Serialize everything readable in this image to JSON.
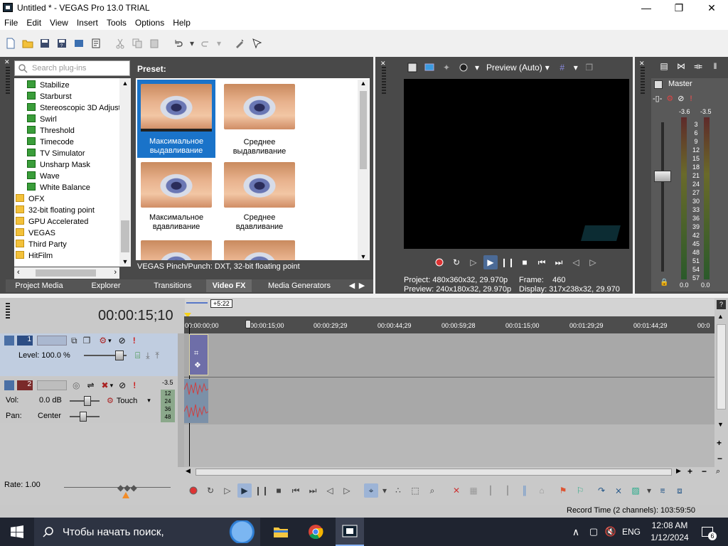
{
  "window": {
    "title": "Untitled * - VEGAS Pro 13.0 TRIAL"
  },
  "menu": [
    "File",
    "Edit",
    "View",
    "Insert",
    "Tools",
    "Options",
    "Help"
  ],
  "explorer": {
    "search_placeholder": "Search plug-ins",
    "tree": [
      {
        "label": "Stabilize",
        "kind": "fx"
      },
      {
        "label": "Starburst",
        "kind": "fx"
      },
      {
        "label": "Stereoscopic 3D Adjust",
        "kind": "fx"
      },
      {
        "label": "Swirl",
        "kind": "fx"
      },
      {
        "label": "Threshold",
        "kind": "fx"
      },
      {
        "label": "Timecode",
        "kind": "fx"
      },
      {
        "label": "TV Simulator",
        "kind": "fx"
      },
      {
        "label": "Unsharp Mask",
        "kind": "fx"
      },
      {
        "label": "Wave",
        "kind": "fx"
      },
      {
        "label": "White Balance",
        "kind": "fx"
      },
      {
        "label": "OFX",
        "kind": "folder"
      },
      {
        "label": "32-bit floating point",
        "kind": "folder"
      },
      {
        "label": "GPU Accelerated",
        "kind": "folder"
      },
      {
        "label": "VEGAS",
        "kind": "folder"
      },
      {
        "label": "Third Party",
        "kind": "folder"
      },
      {
        "label": "HitFilm",
        "kind": "folder"
      }
    ],
    "preset_label": "Preset:",
    "presets": [
      {
        "label": "Максимальное выдавливание",
        "selected": true
      },
      {
        "label": "Среднее выдавливание",
        "selected": false
      },
      {
        "label": "Максимальное вдавливание",
        "selected": false
      },
      {
        "label": "Среднее вдавливание",
        "selected": false
      }
    ],
    "description": "VEGAS Pinch/Punch: DXT, 32-bit floating point",
    "tabs": [
      "Project Media",
      "Explorer",
      "Transitions",
      "Video FX",
      "Media Generators"
    ],
    "active_tab": "Video FX"
  },
  "preview": {
    "quality": "Preview (Auto)",
    "project_label": "Project:",
    "project_value": "480x360x32, 29.970p",
    "preview_label": "Preview:",
    "preview_value": "240x180x32, 29.970p",
    "frame_label": "Frame:",
    "frame_value": "460",
    "display_label": "Display:",
    "display_value": "317x238x32, 29.970"
  },
  "master": {
    "label": "Master",
    "peak_left": "-3.6",
    "peak_right": "-3.5",
    "scale": [
      "3",
      "6",
      "9",
      "12",
      "15",
      "18",
      "21",
      "24",
      "27",
      "30",
      "33",
      "36",
      "39",
      "42",
      "45",
      "48",
      "51",
      "54",
      "57"
    ],
    "level_left": "0.0",
    "level_right": "0.0"
  },
  "timeline": {
    "timecode": "00:00:15;10",
    "region": "+5:22",
    "ruler": [
      "00:00:00;00",
      "00:00:15;00",
      "00:00:29;29",
      "00:00:44;29",
      "00:00:59;28",
      "00:01:15;00",
      "00:01:29;29",
      "00:01:44;29",
      "00:0"
    ],
    "track1": {
      "number": "1",
      "level": "Level: 100.0 %"
    },
    "track2": {
      "number": "2",
      "vol_label": "Vol:",
      "vol_value": "0.0 dB",
      "pan_label": "Pan:",
      "pan_value": "Center",
      "mode": "Touch",
      "peak": "-3.5",
      "meter": [
        "12",
        "24",
        "36",
        "48"
      ]
    },
    "rate": "Rate: 1.00"
  },
  "status": {
    "record_time": "Record Time (2 channels): 103:59:50"
  },
  "taskbar": {
    "search_placeholder": "Чтобы начать поиск,",
    "lang": "ENG",
    "time": "12:08 AM",
    "date": "1/12/2024",
    "notifications": "6"
  },
  "colors": {
    "selection": "#1a73c9",
    "panel_dark": "#494949",
    "track_video": "#c0cde0",
    "clip": "#6e6ea8"
  }
}
